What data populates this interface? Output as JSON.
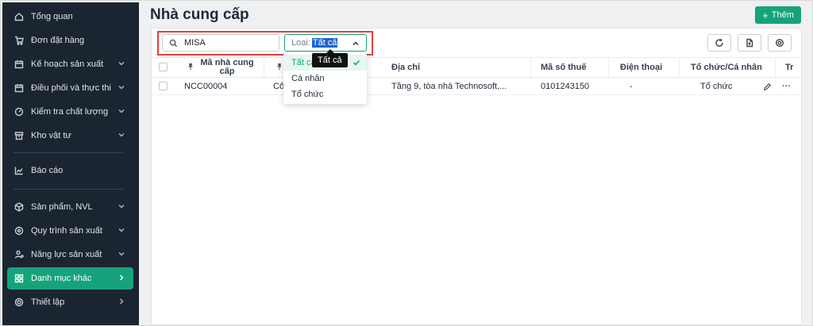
{
  "sidebar": {
    "items": [
      {
        "label": "Tổng quan"
      },
      {
        "label": "Đơn đặt hàng"
      },
      {
        "label": "Kế hoạch sản xuất"
      },
      {
        "label": "Điều phối và thực thi"
      },
      {
        "label": "Kiểm tra chất lượng"
      },
      {
        "label": "Kho vật tư"
      },
      {
        "label": "Báo cáo"
      },
      {
        "label": "Sản phẩm, NVL"
      },
      {
        "label": "Quy trình sản xuất"
      },
      {
        "label": "Năng lực sản xuất"
      },
      {
        "label": "Danh mục khác"
      },
      {
        "label": "Thiết lập"
      }
    ],
    "active_color": "#16a37b",
    "bg_color": "#1b2531"
  },
  "header": {
    "title": "Nhà cung cấp",
    "add_label": "Thêm"
  },
  "filters": {
    "search_value": "MISA",
    "type_prefix": "Loại:",
    "type_value": "Tất cả"
  },
  "table": {
    "columns": [
      "Mã nhà cung cấp",
      "",
      "Địa chỉ",
      "Mã số thuế",
      "Điện thoại",
      "Tổ chức/Cá nhân",
      "Tr"
    ],
    "rows": [
      {
        "code": "NCC00004",
        "name": "Cô",
        "address": "Tầng 9, tòa nhà Technosoft,...",
        "tax": "0101243150",
        "phone": "-",
        "org": "Tổ chức"
      }
    ]
  },
  "dropdown": {
    "options": [
      "Tất cả",
      "Cá nhân",
      "Tổ chức"
    ],
    "tooltip": "Tất cả"
  }
}
